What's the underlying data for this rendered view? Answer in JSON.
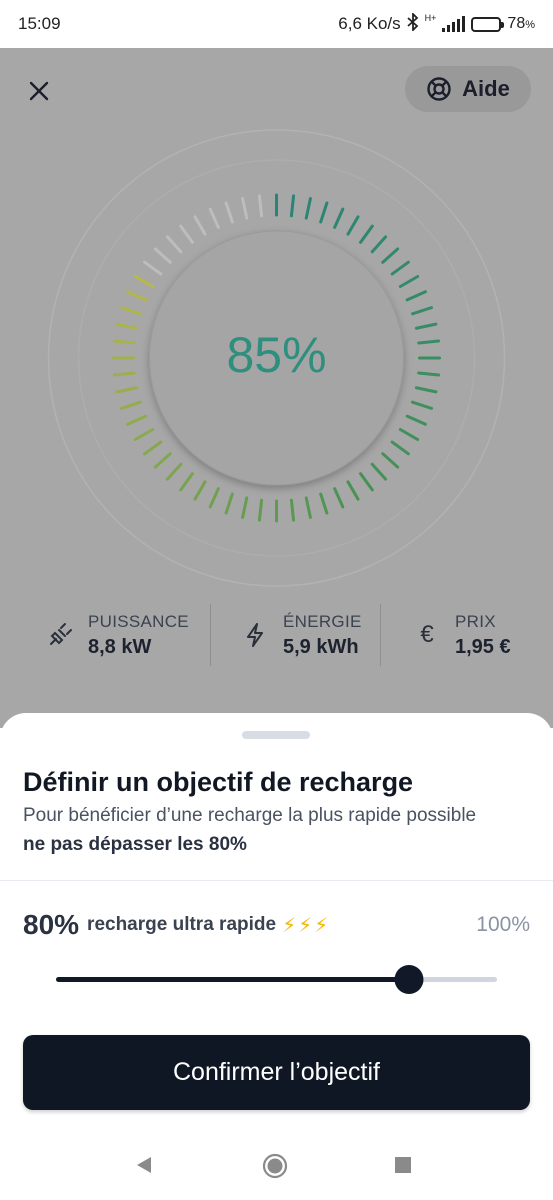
{
  "status_bar": {
    "time": "15:09",
    "speed": "6,6 Ko/s",
    "network": "H+",
    "battery_level": 78,
    "battery_pct": "78",
    "battery_unit": "%"
  },
  "header": {
    "help_label": "Aide"
  },
  "gauge": {
    "value": "85%",
    "level": 0.85
  },
  "stats": [
    {
      "icon": "plug-icon",
      "label": "PUISSANCE",
      "value": "8,8 kW"
    },
    {
      "icon": "bolt-icon",
      "label": "ÉNERGIE",
      "value": "5,9 kWh"
    },
    {
      "icon": "euro-icon",
      "label": "PRIX",
      "value": "1,95 €"
    }
  ],
  "sheet": {
    "title": "Définir un objectif de recharge",
    "description": "Pour bénéficier d’une recharge la plus rapide possible",
    "description_bold": "ne pas dépasser les 80%",
    "target_pct": "80%",
    "target_label": "recharge ultra rapide",
    "target_bolts": "⚡⚡⚡",
    "max_pct": "100%",
    "slider_value": 0.8,
    "confirm_label": "Confirmer l’objectif"
  },
  "colors": {
    "accent": "#2f8f7e",
    "button": "#0f1624",
    "bolt": "#f5b800"
  }
}
